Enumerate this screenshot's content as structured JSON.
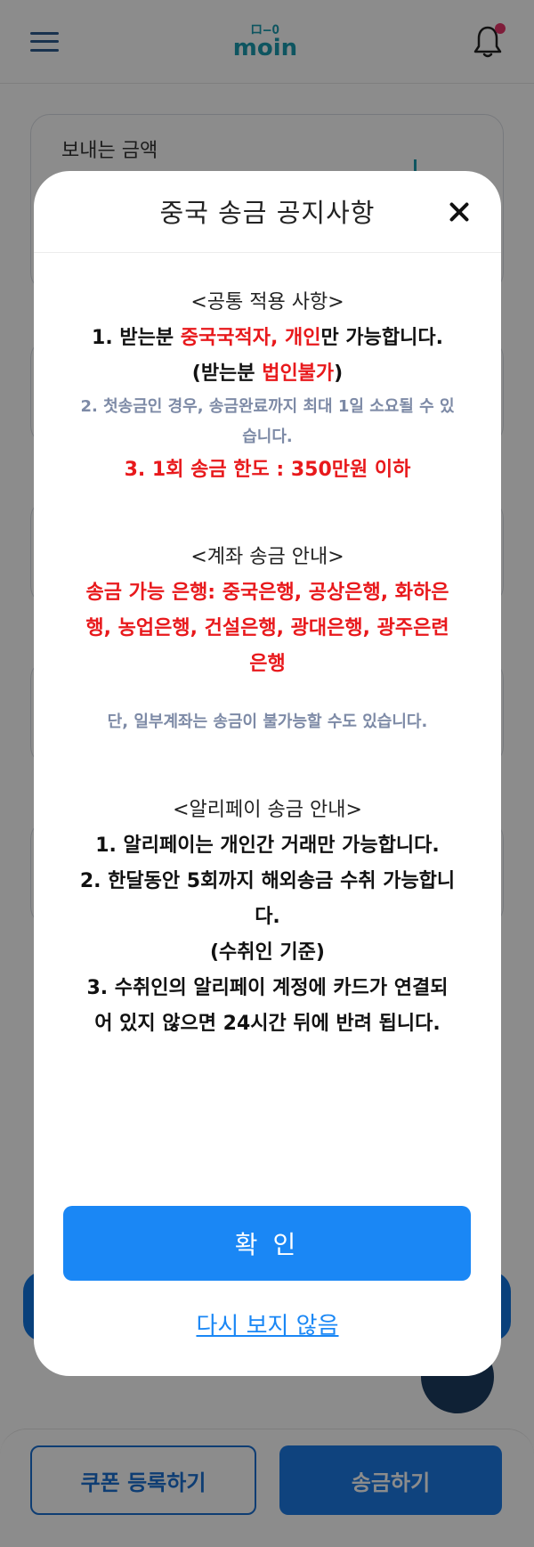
{
  "header": {
    "logo_mark": "ロ–O",
    "logo_text": "moin"
  },
  "amount_card": {
    "label": "보내는 금액"
  },
  "bottom_bar": {
    "coupon_label": "쿠폰 등록하기",
    "send_label": "송금하기"
  },
  "modal": {
    "title": "중국 송금 공지사항",
    "common": {
      "heading": "<공통 적용 사항>",
      "line1_pre": "1. 받는분 ",
      "line1_red": "중국국적자, 개인",
      "line1_post": "만 가능합니다.",
      "line2_pre": "(받는분 ",
      "line2_red": "법인불가",
      "line2_post": ")",
      "note": "2. 첫송금인 경우, 송금완료까지 최대 1일 소요될 수 있습니다.",
      "limit": "3. 1회 송금 한도 : 350만원 이하"
    },
    "account": {
      "heading": "<계좌 송금 안내>",
      "banks": "송금 가능 은행: 중국은행, 공상은행, 화하은행, 농업은행, 건설은행, 광대은행, 광주은련은행",
      "note": "단, 일부계좌는 송금이 불가능할 수도 있습니다."
    },
    "alipay": {
      "heading": "<알리페이 송금 안내>",
      "line1": "1. 알리페이는 개인간 거래만 가능합니다.",
      "line2": "2. 한달동안 5회까지 해외송금 수취 가능합니다.",
      "line3": "(수취인 기준)",
      "line4": "3. 수취인의 알리페이 계정에 카드가 연결되어 있지 않으면 24시간 뒤에 반려 됩니다."
    },
    "confirm_label": "확 인",
    "dont_show_label": "다시 보지 않음"
  },
  "colors": {
    "accent_blue": "#1a87f5",
    "warning_red": "#e8191c",
    "note_grey": "#7d8aa6"
  }
}
